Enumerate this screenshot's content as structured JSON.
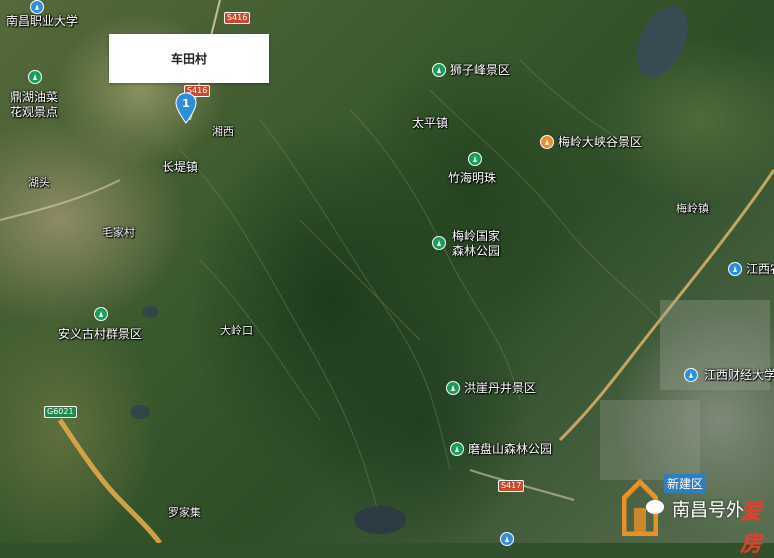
{
  "callout": {
    "label": "车田村"
  },
  "marker": {
    "number": "1",
    "color": "#2b8fdc"
  },
  "places": [
    {
      "id": "nanchang-vocational-univ",
      "label": "南昌职业大学"
    },
    {
      "id": "taiping-town",
      "label": "太平镇"
    },
    {
      "id": "changdi-town",
      "label": "长堤镇"
    },
    {
      "id": "xiangxi",
      "label": "湘西"
    },
    {
      "id": "huxi",
      "label": "湖头"
    },
    {
      "id": "maodian",
      "label": "毛家村"
    },
    {
      "id": "dakoukou",
      "label": "大岭口"
    },
    {
      "id": "meiling-town",
      "label": "梅岭镇"
    },
    {
      "id": "luojiaji",
      "label": "罗家集"
    },
    {
      "id": "jiangxi-agri",
      "label": "江西农"
    },
    {
      "id": "jiangxi-finance",
      "label": "江西财经大学"
    }
  ],
  "pois": [
    {
      "id": "dinghu-rapeseed",
      "label_line1": "鼎湖油菜",
      "label_line2": "花观景点",
      "kind": "scenic"
    },
    {
      "id": "shizifeng",
      "label_line1": "狮子峰景区",
      "label_line2": "",
      "kind": "scenic"
    },
    {
      "id": "meiling-canyon",
      "label_line1": "梅岭大峡谷景区",
      "label_line2": "",
      "kind": "museum"
    },
    {
      "id": "zhuhai-mingzhu",
      "label_line1": "竹海明珠",
      "label_line2": "",
      "kind": "scenic"
    },
    {
      "id": "meiling-forest-park",
      "label_line1": "梅岭国家",
      "label_line2": "森林公园",
      "kind": "scenic"
    },
    {
      "id": "anyi-scenic",
      "label_line1": "安义古村群景区",
      "label_line2": "",
      "kind": "scenic"
    },
    {
      "id": "hongyadanjing",
      "label_line1": "洪崖丹井景区",
      "label_line2": "",
      "kind": "scenic"
    },
    {
      "id": "mopanshan",
      "label_line1": "磨盘山森林公园",
      "label_line2": "",
      "kind": "scenic"
    }
  ],
  "roads": [
    {
      "id": "s416-top",
      "label": "S416",
      "kind": "provincial"
    },
    {
      "id": "s416-mid",
      "label": "S416",
      "kind": "provincial"
    },
    {
      "id": "s417",
      "label": "S417",
      "kind": "provincial"
    },
    {
      "id": "g6021",
      "label": "G6021",
      "kind": "expressway"
    }
  ],
  "watermark": {
    "top_label": "新建区",
    "text": "南昌号外",
    "brand": "爱房"
  }
}
